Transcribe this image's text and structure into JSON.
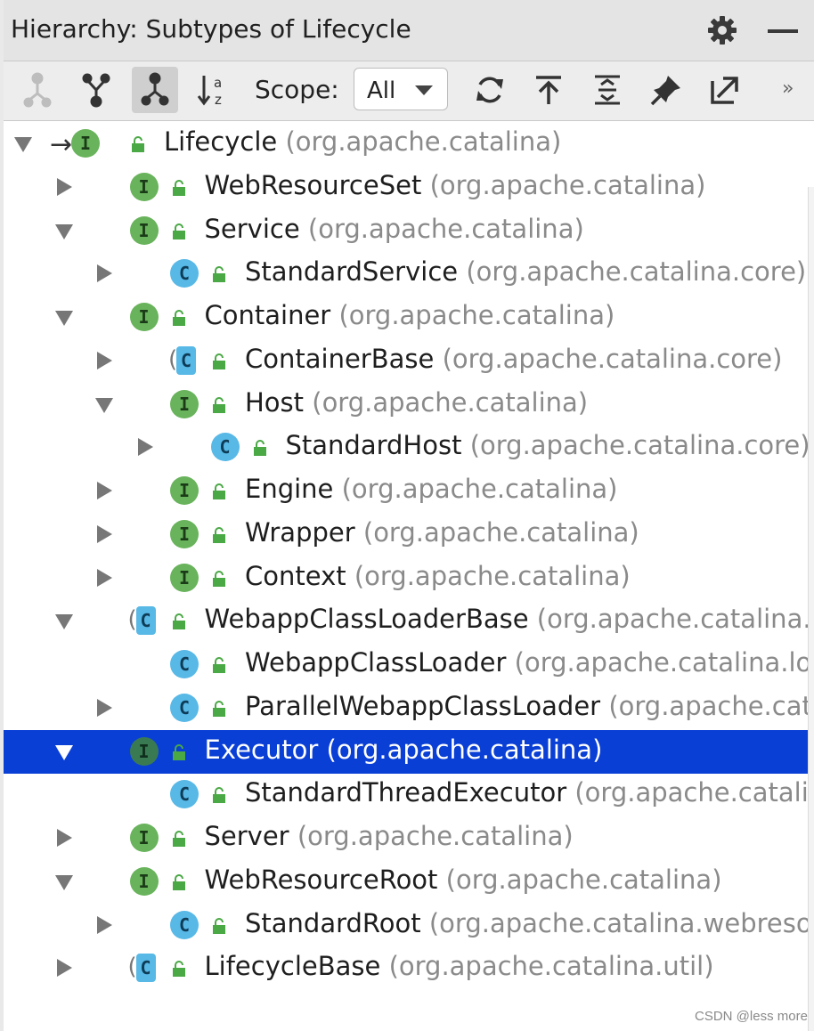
{
  "window": {
    "title": "Hierarchy:  Subtypes of Lifecycle",
    "settings_icon": "gear-icon",
    "minimize_icon": "minimize-icon"
  },
  "toolbar": {
    "buttons": [
      {
        "name": "supertypes-hierarchy",
        "icon": "supertypes-icon",
        "active": false
      },
      {
        "name": "subtypes-hierarchy",
        "icon": "subtypes-icon",
        "active": false
      },
      {
        "name": "class-hierarchy",
        "icon": "class-hierarchy-icon",
        "active": true
      },
      {
        "name": "sort-alphabetically",
        "icon": "sort-az-icon",
        "active": false
      }
    ],
    "scope_label": "Scope:",
    "scope_value": "All",
    "actions": [
      "refresh-icon",
      "export-to-text-icon",
      "expand-all-icon",
      "pin-icon",
      "open-in-new-tab-icon"
    ],
    "more": "»"
  },
  "tree": {
    "rows": [
      {
        "depth": 0,
        "arrow": "expanded",
        "kind": "interface",
        "base": true,
        "name": "Lifecycle",
        "pkg": "(org.apache.catalina)"
      },
      {
        "depth": 1,
        "arrow": "collapsed",
        "kind": "interface",
        "name": "WebResourceSet",
        "pkg": "(org.apache.catalina)"
      },
      {
        "depth": 1,
        "arrow": "expanded",
        "kind": "interface",
        "name": "Service",
        "pkg": "(org.apache.catalina)"
      },
      {
        "depth": 2,
        "arrow": "collapsed",
        "kind": "class",
        "name": "StandardService",
        "pkg": "(org.apache.catalina.core)"
      },
      {
        "depth": 1,
        "arrow": "expanded",
        "kind": "interface",
        "name": "Container",
        "pkg": "(org.apache.catalina)"
      },
      {
        "depth": 2,
        "arrow": "collapsed",
        "kind": "abstract",
        "name": "ContainerBase",
        "pkg": "(org.apache.catalina.core)"
      },
      {
        "depth": 2,
        "arrow": "expanded",
        "kind": "interface",
        "name": "Host",
        "pkg": "(org.apache.catalina)"
      },
      {
        "depth": 3,
        "arrow": "collapsed",
        "kind": "class",
        "name": "StandardHost",
        "pkg": "(org.apache.catalina.core)"
      },
      {
        "depth": 2,
        "arrow": "collapsed",
        "kind": "interface",
        "name": "Engine",
        "pkg": "(org.apache.catalina)"
      },
      {
        "depth": 2,
        "arrow": "collapsed",
        "kind": "interface",
        "name": "Wrapper",
        "pkg": "(org.apache.catalina)"
      },
      {
        "depth": 2,
        "arrow": "collapsed",
        "kind": "interface",
        "name": "Context",
        "pkg": "(org.apache.catalina)"
      },
      {
        "depth": 1,
        "arrow": "expanded",
        "kind": "abstract",
        "name": "WebappClassLoaderBase",
        "pkg": "(org.apache.catalina.lo"
      },
      {
        "depth": 2,
        "arrow": "none",
        "kind": "class",
        "name": "WebappClassLoader",
        "pkg": "(org.apache.catalina.loa"
      },
      {
        "depth": 2,
        "arrow": "collapsed",
        "kind": "class",
        "name": "ParallelWebappClassLoader",
        "pkg": "(org.apache.catal"
      },
      {
        "depth": 1,
        "arrow": "expanded",
        "kind": "interface",
        "selected": true,
        "name": "Executor",
        "pkg": "(org.apache.catalina)"
      },
      {
        "depth": 2,
        "arrow": "none",
        "kind": "class",
        "name": "StandardThreadExecutor",
        "pkg": "(org.apache.catalin"
      },
      {
        "depth": 1,
        "arrow": "collapsed",
        "kind": "interface",
        "name": "Server",
        "pkg": "(org.apache.catalina)"
      },
      {
        "depth": 1,
        "arrow": "expanded",
        "kind": "interface",
        "name": "WebResourceRoot",
        "pkg": "(org.apache.catalina)"
      },
      {
        "depth": 2,
        "arrow": "collapsed",
        "kind": "class",
        "name": "StandardRoot",
        "pkg": "(org.apache.catalina.webresou"
      },
      {
        "depth": 1,
        "arrow": "collapsed",
        "kind": "abstract",
        "name": "LifecycleBase",
        "pkg": "(org.apache.catalina.util)"
      }
    ]
  },
  "badges": {
    "interface": "I",
    "class": "C",
    "abstract": "C"
  },
  "base_marker": "→",
  "watermark": "CSDN @less more",
  "colors": {
    "selection": "#0a3fd6",
    "interface_badge": "#68b35b",
    "class_badge": "#58b8e6",
    "lock": "#4aa845"
  }
}
